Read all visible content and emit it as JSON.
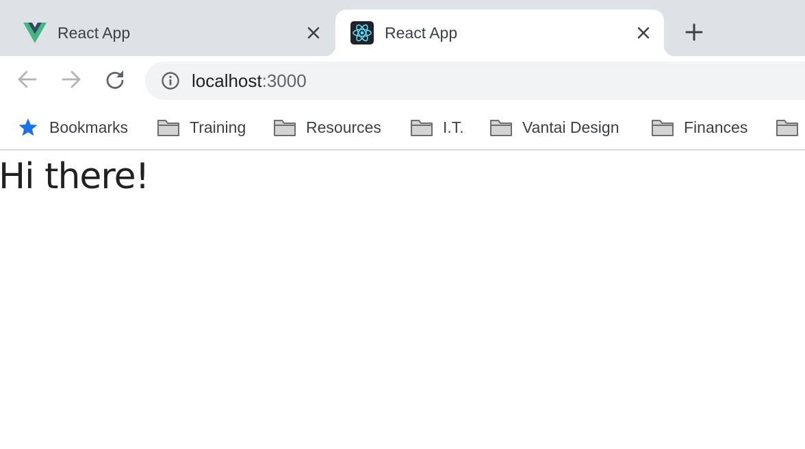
{
  "browser": {
    "tabs": [
      {
        "title": "React App",
        "favicon": "vue-logo-icon",
        "active": false
      },
      {
        "title": "React App",
        "favicon": "react-logo-icon",
        "active": true
      }
    ],
    "new_tab_icon": "plus-icon",
    "address": {
      "host": "localhost",
      "port": ":3000",
      "info_icon": "info-icon"
    },
    "nav_icons": [
      "back-arrow-icon",
      "forward-arrow-icon",
      "reload-icon"
    ]
  },
  "bookmarks": [
    {
      "label": "Bookmarks",
      "icon": "star-icon"
    },
    {
      "label": "Training",
      "icon": "folder-icon"
    },
    {
      "label": "Resources",
      "icon": "folder-icon"
    },
    {
      "label": "I.T.",
      "icon": "folder-icon"
    },
    {
      "label": "Vantai Design",
      "icon": "folder-icon"
    },
    {
      "label": "Finances",
      "icon": "folder-icon"
    },
    {
      "label": "",
      "icon": "folder-icon"
    }
  ],
  "page": {
    "heading": "Hi there!"
  },
  "colors": {
    "tabstrip_bg": "#dee1e6",
    "omnibox_bg": "#f1f3f4",
    "star": "#1a73e8",
    "vue_green": "#41b883",
    "vue_dark": "#35495e",
    "react_blue": "#61dafb"
  }
}
